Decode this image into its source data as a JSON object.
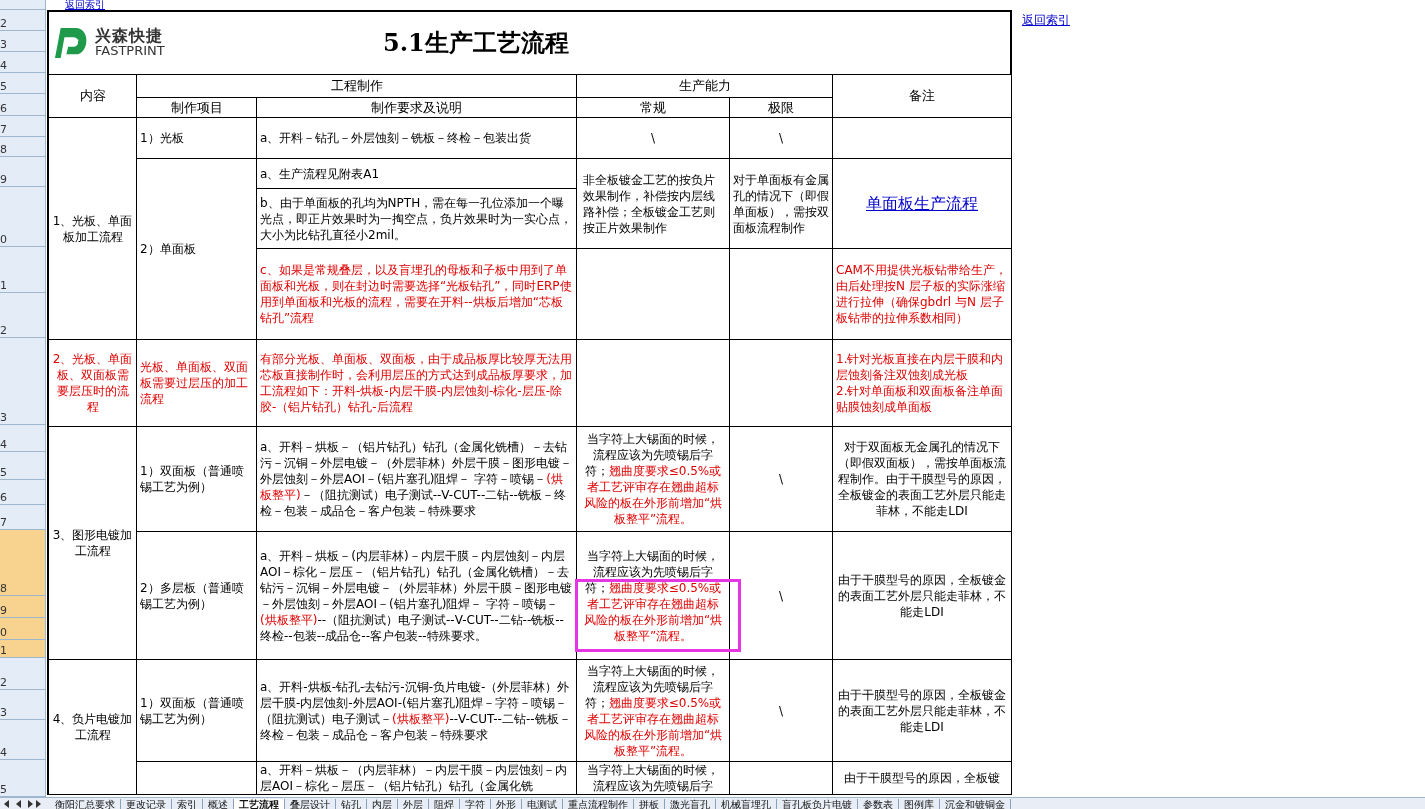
{
  "back_link_top": "返回索引",
  "back_link_side": "返回索引",
  "logo": {
    "name": "兴森快捷",
    "subtitle": "FASTPRINT"
  },
  "title": "5.1生产工艺流程",
  "row_headers": [
    {
      "label": "2",
      "selected": false
    },
    {
      "label": "3",
      "selected": false
    },
    {
      "label": "4",
      "selected": false
    },
    {
      "label": "5",
      "selected": false
    },
    {
      "label": "6",
      "selected": false
    },
    {
      "label": "7",
      "selected": false
    },
    {
      "label": "8",
      "selected": false
    },
    {
      "label": "9",
      "selected": false
    },
    {
      "label": "0",
      "selected": false
    },
    {
      "label": "1",
      "selected": false
    },
    {
      "label": "2",
      "selected": false
    },
    {
      "label": "3",
      "selected": false
    },
    {
      "label": "4",
      "selected": false
    },
    {
      "label": "5",
      "selected": false
    },
    {
      "label": "6",
      "selected": false
    },
    {
      "label": "7",
      "selected": false
    },
    {
      "label": "8",
      "selected": true
    },
    {
      "label": "9",
      "selected": true
    },
    {
      "label": "0",
      "selected": true
    },
    {
      "label": "1",
      "selected": true
    },
    {
      "label": "2",
      "selected": false
    },
    {
      "label": "3",
      "selected": false
    },
    {
      "label": "4",
      "selected": false
    },
    {
      "label": "5",
      "selected": false
    }
  ],
  "headers": [
    "内容",
    "工程制作",
    "生产能力",
    "备注",
    "制作项目",
    "制作要求及说明",
    "常规",
    "极限"
  ],
  "cells": [
    {
      "kind": "text",
      "parts": [
        {
          "text": "1、光板、单面板加工流程",
          "warning": false
        }
      ]
    },
    {
      "kind": "text",
      "parts": [
        {
          "text": "1）光板",
          "warning": false
        }
      ]
    },
    {
      "kind": "text",
      "parts": [
        {
          "text": "a、开料－钻孔－外层蚀刻－铣板－终检－包装出货",
          "warning": false
        }
      ]
    },
    {
      "kind": "text",
      "parts": [
        {
          "text": "\\",
          "warning": false
        }
      ]
    },
    {
      "kind": "text",
      "parts": [
        {
          "text": "\\",
          "warning": false
        }
      ]
    },
    {
      "kind": "text",
      "parts": [
        {
          "text": "2）单面板",
          "warning": false
        }
      ]
    },
    {
      "kind": "text",
      "parts": [
        {
          "text": "a、生产流程见附表A1",
          "warning": false
        }
      ]
    },
    {
      "kind": "text",
      "parts": [
        {
          "text": "b、由于单面板的孔均为NPTH，需在每一孔位添加一个曝光点，即正片效果时为一掏空点，负片效果时为一实心点，大小为比钻孔直径小2mil。",
          "warning": false
        }
      ]
    },
    {
      "kind": "text",
      "parts": [
        {
          "text": "非全板镀金工艺的按负片效果制作，补偿按内层线路补偿；全板镀金工艺则按正片效果制作",
          "warning": false
        }
      ]
    },
    {
      "kind": "text",
      "parts": [
        {
          "text": "对于单面板有金属孔的情况下（即假单面板），需按双面板流程制作",
          "warning": false
        }
      ]
    },
    {
      "kind": "link",
      "text": "单面板生产流程"
    },
    {
      "kind": "text",
      "parts": [
        {
          "text": "c、如果是常规叠层，以及盲埋孔的母板和子板中用到了单面板和光板，则在封边时需要选择“光板钻孔”，同时ERP使用到单面板和光板的流程，需要在开料--烘板后增加“芯板钻孔”流程",
          "warning": true
        }
      ]
    },
    {
      "kind": "text",
      "parts": [
        {
          "text": "CAM不用提供光板钻带给生产，由后处理按N 层子板的实际涨缩进行拉伸（确保gbdrl 与N 层子板钻带的拉伸系数相同）",
          "warning": true
        }
      ]
    },
    {
      "kind": "text",
      "parts": [
        {
          "text": "2、光板、单面板、双面板需要层压时的流程",
          "warning": true
        }
      ]
    },
    {
      "kind": "text",
      "parts": [
        {
          "text": "光板、单面板、双面板需要过层压的加工流程",
          "warning": true
        }
      ]
    },
    {
      "kind": "text",
      "parts": [
        {
          "text": "有部分光板、单面板、双面板，由于成品板厚比较厚无法用芯板直接制作时，会利用层压的方式达到成品板厚要求，加工流程如下：开料-烘板-内层干膜-内层蚀刻-棕化-层压-除胶-（铝片钻孔）钻孔-后流程",
          "warning": true
        }
      ]
    },
    {
      "kind": "text",
      "parts": [
        {
          "text": "1.针对光板直接在内层干膜和内层蚀刻备注双蚀刻成光板\n2.针对单面板和双面板备注单面贴膜蚀刻成单面板",
          "warning": true
        }
      ]
    },
    {
      "kind": "text",
      "parts": [
        {
          "text": "3、图形电镀加工流程",
          "warning": false
        }
      ]
    },
    {
      "kind": "text",
      "parts": [
        {
          "text": "1）双面板（普通喷锡工艺为例）",
          "warning": false
        }
      ]
    },
    {
      "kind": "text",
      "parts": [
        {
          "text": "a、开料－烘板－（铝片钻孔）钻孔（金属化铣槽）－去钻污－沉铜－外层电镀－（外层菲林）外层干膜－图形电镀－外层蚀刻－外层AOI－(铝片塞孔)阻焊－ 字符－喷锡－",
          "warning": false
        },
        {
          "text": "(烘板整平)",
          "warning": true
        },
        {
          "text": "－（阻抗测试）电子测试--V-CUT--二钻--铣板－终检－包装－成品仓－客户包装－特殊要求",
          "warning": false
        }
      ]
    },
    {
      "kind": "text",
      "parts": [
        {
          "text": "当字符上大锡面的时候，流程应该为先喷锡后字符；",
          "warning": false
        },
        {
          "text": "翘曲度要求≤0.5%或者工艺评审存在翘曲超标风险的板在外形前增加“烘板整平”流程。",
          "warning": true
        }
      ]
    },
    {
      "kind": "text",
      "parts": [
        {
          "text": "\\",
          "warning": false
        }
      ]
    },
    {
      "kind": "text",
      "parts": [
        {
          "text": "对于双面板无金属孔的情况下（即假双面板），需按单面板流程制作。由于干膜型号的原因，全板镀金的表面工艺外层只能走菲林，不能走LDI",
          "warning": false
        }
      ]
    },
    {
      "kind": "text",
      "parts": [
        {
          "text": "2）多层板（普通喷锡工艺为例）",
          "warning": false
        }
      ]
    },
    {
      "kind": "text",
      "parts": [
        {
          "text": "a、开料－烘板－(内层菲林)－内层干膜－内层蚀刻－内层AOI－棕化－层压－（铝片钻孔）钻孔（金属化铣槽）－去钻污－沉铜－外层电镀－（外层菲林）外层干膜－图形电镀－外层蚀刻－外层AOI－(铝片塞孔)阻焊－ 字符－喷锡－",
          "warning": false
        },
        {
          "text": "(烘板整平)",
          "warning": true
        },
        {
          "text": "--（阻抗测试）电子测试--V-CUT--二钻--铣板--终检--包装--成品仓--客户包装--特殊要求。",
          "warning": false
        }
      ]
    },
    {
      "kind": "text",
      "parts": [
        {
          "text": "当字符上大锡面的时候，流程应该为先喷锡后字符；",
          "warning": false
        },
        {
          "text": "翘曲度要求≤0.5%或者工艺评审存在翘曲超标风险的板在外形前增加“烘板整平”流程。",
          "warning": true
        }
      ]
    },
    {
      "kind": "text",
      "parts": [
        {
          "text": "\\",
          "warning": false
        }
      ]
    },
    {
      "kind": "text",
      "parts": [
        {
          "text": "由于干膜型号的原因，全板镀金的表面工艺外层只能走菲林，不能走LDI",
          "warning": false
        }
      ]
    },
    {
      "kind": "text",
      "parts": [
        {
          "text": "4、负片电镀加工流程",
          "warning": false
        }
      ]
    },
    {
      "kind": "text",
      "parts": [
        {
          "text": "1）双面板（普通喷锡工艺为例）",
          "warning": false
        }
      ]
    },
    {
      "kind": "text",
      "parts": [
        {
          "text": "a、开料-烘板-钻孔-去钻污-沉铜-负片电镀-（外层菲林）外层干膜-内层蚀刻-外层AOI-(铝片塞孔)阻焊－字符－喷锡－（阻抗测试）电子测试－",
          "warning": false
        },
        {
          "text": "(烘板整平)",
          "warning": true
        },
        {
          "text": "--V-CUT--二钻--铣板－终检－包装－成品仓－客户包装－特殊要求",
          "warning": false
        }
      ]
    },
    {
      "kind": "text",
      "parts": [
        {
          "text": "当字符上大锡面的时候，流程应该为先喷锡后字符；",
          "warning": false
        },
        {
          "text": "翘曲度要求≤0.5%或者工艺评审存在翘曲超标风险的板在外形前增加“烘板整平”流程。",
          "warning": true
        }
      ]
    },
    {
      "kind": "text",
      "parts": [
        {
          "text": "\\",
          "warning": false
        }
      ]
    },
    {
      "kind": "text",
      "parts": [
        {
          "text": "由于干膜型号的原因，全板镀金的表面工艺外层只能走菲林，不能走LDI",
          "warning": false
        }
      ]
    },
    {
      "kind": "text",
      "parts": [
        {
          "text": "a、开料－烘板－（内层菲林）－内层干膜－内层蚀刻－内层AOI－棕化－层压－（铝片钻孔）钻孔（金属化铣",
          "warning": false
        }
      ]
    },
    {
      "kind": "text",
      "parts": [
        {
          "text": "当字符上大锡面的时候，流程应该为先喷锡后字",
          "warning": false
        }
      ]
    },
    {
      "kind": "text",
      "parts": [
        {
          "text": "由于干膜型号的原因，全板镀",
          "warning": false
        }
      ]
    }
  ],
  "sheet_tabs": [
    {
      "label": "衡阳汇总要求",
      "selected": false
    },
    {
      "label": "更改记录",
      "selected": false
    },
    {
      "label": "索引",
      "selected": false
    },
    {
      "label": "概述",
      "selected": false
    },
    {
      "label": "工艺流程",
      "selected": true
    },
    {
      "label": "叠层设计",
      "selected": false
    },
    {
      "label": "钻孔",
      "selected": false
    },
    {
      "label": "内层",
      "selected": false
    },
    {
      "label": "外层",
      "selected": false
    },
    {
      "label": "阻焊",
      "selected": false
    },
    {
      "label": "字符",
      "selected": false
    },
    {
      "label": "外形",
      "selected": false
    },
    {
      "label": "电测试",
      "selected": false
    },
    {
      "label": "重点流程制作",
      "selected": false
    },
    {
      "label": "拼板",
      "selected": false
    },
    {
      "label": "激光盲孔",
      "selected": false
    },
    {
      "label": "机械盲埋孔",
      "selected": false
    },
    {
      "label": "盲孔板负片电镀",
      "selected": false
    },
    {
      "label": "参数表",
      "selected": false
    },
    {
      "label": "图例库",
      "selected": false
    },
    {
      "label": "沉金和镀铜金",
      "selected": false
    }
  ]
}
